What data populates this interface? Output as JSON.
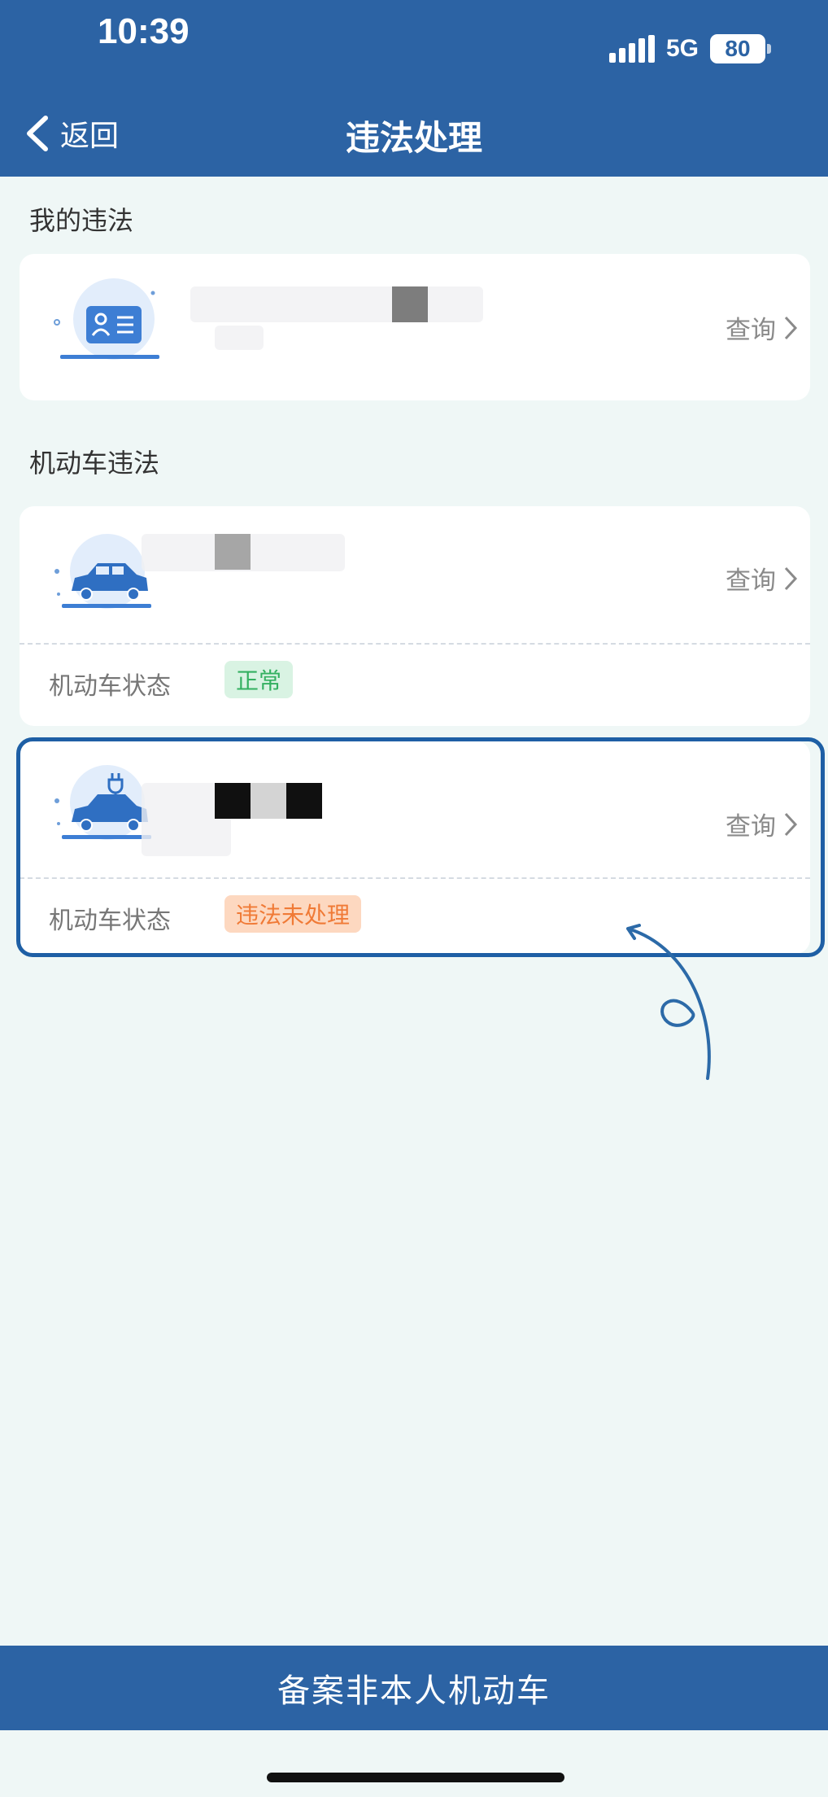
{
  "status_bar": {
    "time": "10:39",
    "network": "5G",
    "battery": "80"
  },
  "nav": {
    "back_label": "返回",
    "title": "违法处理"
  },
  "sections": {
    "my_violations_title": "我的违法",
    "vehicle_violations_title": "机动车违法"
  },
  "my_violation_card": {
    "query_label": "查询"
  },
  "vehicle_cards": [
    {
      "query_label": "查询",
      "status_label": "机动车状态",
      "status_value": "正常",
      "status_color": "#33b060"
    },
    {
      "query_label": "查询",
      "status_label": "机动车状态",
      "status_value": "违法未处理",
      "status_color": "#f07a36"
    }
  ],
  "bottom_button": {
    "label": "备案非本人机动车"
  },
  "colors": {
    "primary": "#2c63a4",
    "background": "#eff7f6",
    "ok": "#33b060",
    "warn": "#f07a36"
  },
  "icons": [
    "back-chevron-icon",
    "id-card-icon",
    "car-icon",
    "electric-car-icon",
    "chevron-right-icon"
  ]
}
